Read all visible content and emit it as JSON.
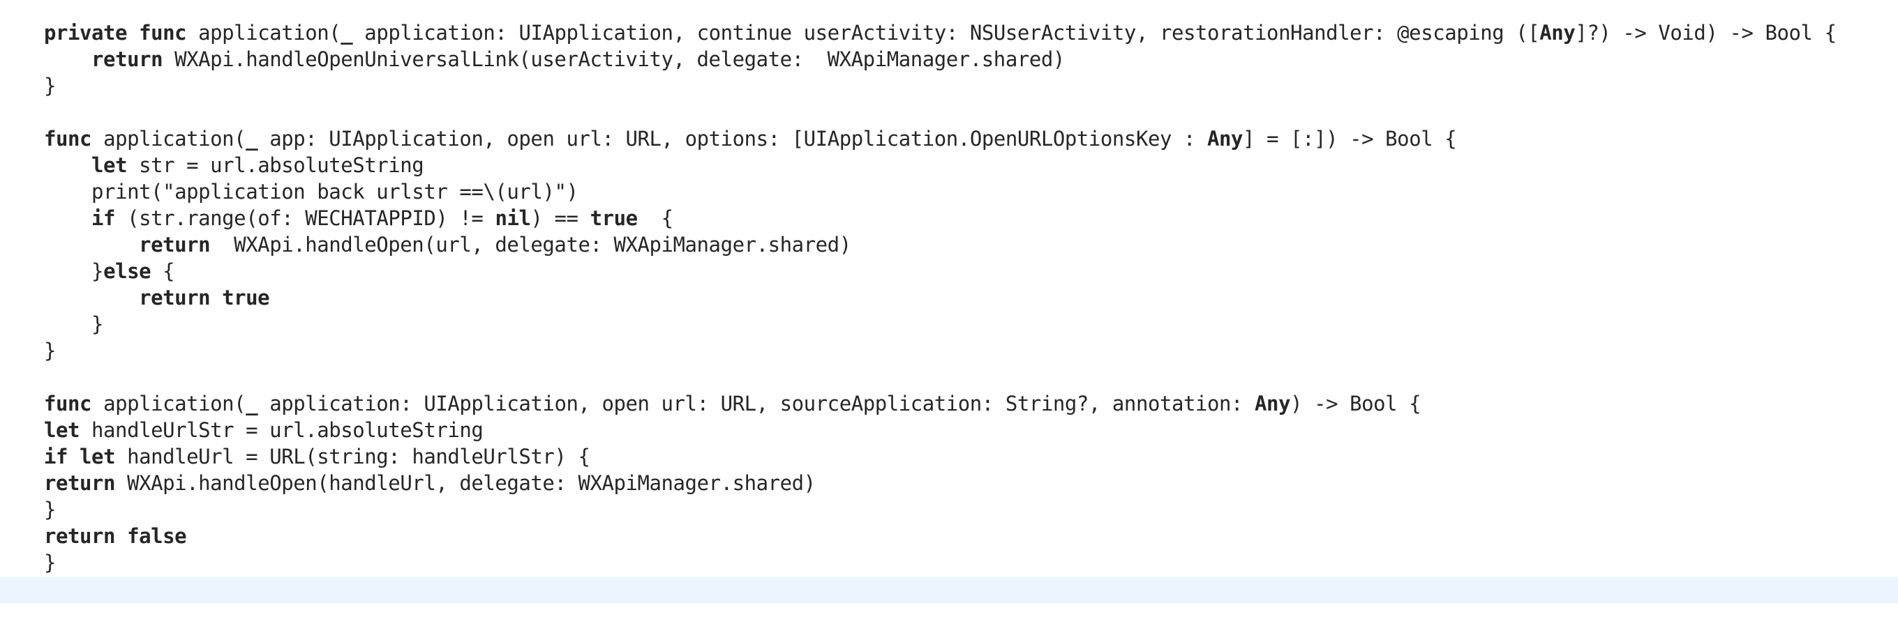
{
  "editor": {
    "lines": [
      [
        {
          "t": "private",
          "c": "kw"
        },
        {
          "t": " ",
          "c": "plain"
        },
        {
          "t": "func",
          "c": "kw"
        },
        {
          "t": " ",
          "c": "plain"
        },
        {
          "t": "application",
          "c": "fn"
        },
        {
          "t": "(",
          "c": "plain"
        },
        {
          "t": "_",
          "c": "kw"
        },
        {
          "t": " application: ",
          "c": "plain"
        },
        {
          "t": "UIApplication",
          "c": "ty"
        },
        {
          "t": ", continue userActivity: ",
          "c": "plain"
        },
        {
          "t": "NSUserActivity",
          "c": "ty"
        },
        {
          "t": ", restorationHandler: ",
          "c": "plain"
        },
        {
          "t": "@escaping",
          "c": "at"
        },
        {
          "t": " ([",
          "c": "plain"
        },
        {
          "t": "Any",
          "c": "kw"
        },
        {
          "t": "]?) -> ",
          "c": "plain"
        },
        {
          "t": "Void",
          "c": "ty"
        },
        {
          "t": ") -> ",
          "c": "plain"
        },
        {
          "t": "Bool",
          "c": "ty"
        },
        {
          "t": " {",
          "c": "plain"
        }
      ],
      [
        {
          "t": "    ",
          "c": "plain"
        },
        {
          "t": "return",
          "c": "kw"
        },
        {
          "t": " WXApi.",
          "c": "plain"
        },
        {
          "t": "handleOpenUniversalLink",
          "c": "me"
        },
        {
          "t": "(userActivity, delegate:  ",
          "c": "plain"
        },
        {
          "t": "WXApiManager",
          "c": "me"
        },
        {
          "t": ".",
          "c": "plain"
        },
        {
          "t": "shared",
          "c": "me"
        },
        {
          "t": ")",
          "c": "plain"
        }
      ],
      [
        {
          "t": "}",
          "c": "plain"
        }
      ],
      [],
      [
        {
          "t": "func",
          "c": "kw"
        },
        {
          "t": " ",
          "c": "plain"
        },
        {
          "t": "application",
          "c": "fn"
        },
        {
          "t": "(",
          "c": "plain"
        },
        {
          "t": "_",
          "c": "kw"
        },
        {
          "t": " app: ",
          "c": "plain"
        },
        {
          "t": "UIApplication",
          "c": "ty"
        },
        {
          "t": ", open url: ",
          "c": "plain"
        },
        {
          "t": "URL",
          "c": "ty"
        },
        {
          "t": ", options: [",
          "c": "plain"
        },
        {
          "t": "UIApplication",
          "c": "ty"
        },
        {
          "t": ".",
          "c": "plain"
        },
        {
          "t": "OpenURLOptionsKey",
          "c": "ty"
        },
        {
          "t": " : ",
          "c": "plain"
        },
        {
          "t": "Any",
          "c": "kw"
        },
        {
          "t": "] = [:]) -> ",
          "c": "plain"
        },
        {
          "t": "Bool",
          "c": "ty"
        },
        {
          "t": " {",
          "c": "plain"
        }
      ],
      [
        {
          "t": "    ",
          "c": "plain"
        },
        {
          "t": "let",
          "c": "kw"
        },
        {
          "t": " str = url.",
          "c": "plain"
        },
        {
          "t": "absoluteString",
          "c": "pr"
        }
      ],
      [
        {
          "t": "    ",
          "c": "plain"
        },
        {
          "t": "print",
          "c": "pr"
        },
        {
          "t": "(",
          "c": "plain"
        },
        {
          "t": "\"application back urlstr ==",
          "c": "st"
        },
        {
          "t": "\\(url)",
          "c": "plain"
        },
        {
          "t": "\"",
          "c": "st"
        },
        {
          "t": ")",
          "c": "plain"
        }
      ],
      [
        {
          "t": "    ",
          "c": "plain"
        },
        {
          "t": "if",
          "c": "kw"
        },
        {
          "t": " (str.",
          "c": "plain"
        },
        {
          "t": "range",
          "c": "pr"
        },
        {
          "t": "(of: ",
          "c": "plain"
        },
        {
          "t": "WECHATAPPID",
          "c": "me"
        },
        {
          "t": ") ",
          "c": "plain"
        },
        {
          "t": "!=",
          "c": "pr"
        },
        {
          "t": " ",
          "c": "plain"
        },
        {
          "t": "nil",
          "c": "kw"
        },
        {
          "t": ") ",
          "c": "plain"
        },
        {
          "t": "==",
          "c": "pr"
        },
        {
          "t": " ",
          "c": "plain"
        },
        {
          "t": "true",
          "c": "kw"
        },
        {
          "t": "  {",
          "c": "plain"
        }
      ],
      [
        {
          "t": "        ",
          "c": "plain"
        },
        {
          "t": "return",
          "c": "kw"
        },
        {
          "t": "  WXApi.",
          "c": "plain"
        },
        {
          "t": "handleOpen",
          "c": "me"
        },
        {
          "t": "(url, delegate: ",
          "c": "plain"
        },
        {
          "t": "WXApiManager",
          "c": "me"
        },
        {
          "t": ".",
          "c": "plain"
        },
        {
          "t": "shared",
          "c": "me"
        },
        {
          "t": ")",
          "c": "plain"
        }
      ],
      [
        {
          "t": "    }",
          "c": "plain"
        },
        {
          "t": "else",
          "c": "kw"
        },
        {
          "t": " {",
          "c": "plain"
        }
      ],
      [
        {
          "t": "        ",
          "c": "plain"
        },
        {
          "t": "return",
          "c": "kw"
        },
        {
          "t": " ",
          "c": "plain"
        },
        {
          "t": "true",
          "c": "kw"
        }
      ],
      [
        {
          "t": "    }",
          "c": "plain"
        }
      ],
      [
        {
          "t": "}",
          "c": "plain"
        }
      ],
      [],
      [
        {
          "t": "func",
          "c": "kw"
        },
        {
          "t": " ",
          "c": "plain"
        },
        {
          "t": "application",
          "c": "fn"
        },
        {
          "t": "(",
          "c": "plain"
        },
        {
          "t": "_",
          "c": "kw"
        },
        {
          "t": " application: ",
          "c": "plain"
        },
        {
          "t": "UIApplication",
          "c": "ty"
        },
        {
          "t": ", open url: ",
          "c": "plain"
        },
        {
          "t": "URL",
          "c": "ty"
        },
        {
          "t": ", sourceApplication: ",
          "c": "plain"
        },
        {
          "t": "String",
          "c": "ty"
        },
        {
          "t": "?, annotation: ",
          "c": "plain"
        },
        {
          "t": "Any",
          "c": "kw"
        },
        {
          "t": ") -> ",
          "c": "plain"
        },
        {
          "t": "Bool",
          "c": "ty"
        },
        {
          "t": " {",
          "c": "plain"
        }
      ],
      [
        {
          "t": "let",
          "c": "kw"
        },
        {
          "t": " handleUrlStr = url.",
          "c": "plain"
        },
        {
          "t": "absoluteString",
          "c": "pr"
        }
      ],
      [
        {
          "t": "if",
          "c": "kw"
        },
        {
          "t": " ",
          "c": "plain"
        },
        {
          "t": "let",
          "c": "kw"
        },
        {
          "t": " handleUrl = ",
          "c": "plain"
        },
        {
          "t": "URL",
          "c": "ty"
        },
        {
          "t": "(string: handleUrlStr) {",
          "c": "plain"
        }
      ],
      [
        {
          "t": "return",
          "c": "kw"
        },
        {
          "t": " WXApi.",
          "c": "plain"
        },
        {
          "t": "handleOpen",
          "c": "me"
        },
        {
          "t": "(handleUrl, delegate: ",
          "c": "plain"
        },
        {
          "t": "WXApiManager",
          "c": "me"
        },
        {
          "t": ".",
          "c": "plain"
        },
        {
          "t": "shared",
          "c": "me"
        },
        {
          "t": ")",
          "c": "plain"
        }
      ],
      [
        {
          "t": "}",
          "c": "plain"
        }
      ],
      [
        {
          "t": "return",
          "c": "kw"
        },
        {
          "t": " ",
          "c": "plain"
        },
        {
          "t": "false",
          "c": "kw"
        }
      ],
      [
        {
          "t": "}",
          "c": "plain"
        }
      ]
    ]
  },
  "colors": {
    "background": "#ffffff",
    "current_line_highlight": "#ecf5ff",
    "keyword": "#9b2393",
    "function_name": "#0f68a0",
    "type": "#3900a0",
    "method": "#326d74",
    "property": "#6c36a9",
    "string": "#c41a16",
    "plain": "#262626"
  }
}
